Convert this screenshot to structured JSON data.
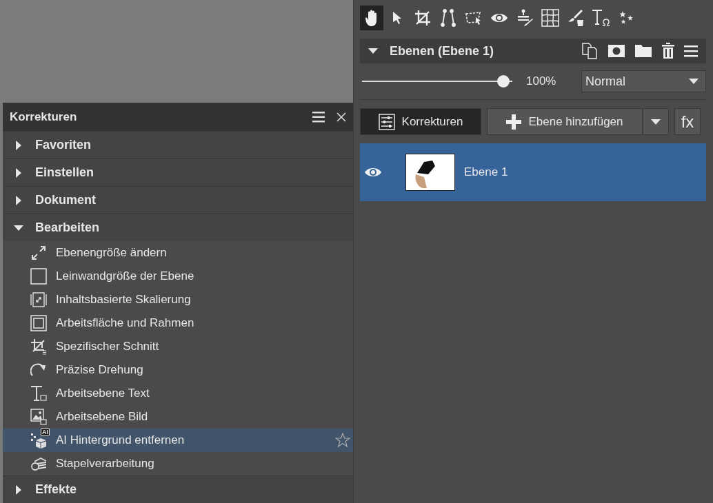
{
  "tools": [
    {
      "kind": "hand",
      "selected": true
    },
    {
      "kind": "pointer",
      "selected": false
    },
    {
      "kind": "crop",
      "selected": false
    },
    {
      "kind": "perspective",
      "selected": false
    },
    {
      "kind": "selection",
      "selected": false
    },
    {
      "kind": "eye",
      "selected": false
    },
    {
      "kind": "stamp",
      "selected": false
    },
    {
      "kind": "warp",
      "selected": false
    },
    {
      "kind": "brush",
      "selected": false
    },
    {
      "kind": "text",
      "selected": false
    },
    {
      "kind": "stars",
      "selected": false
    }
  ],
  "layers_panel": {
    "title": "Ebenen (Ebene 1)",
    "expanded": true,
    "opacity": {
      "level": 0.98,
      "reading": "100%"
    },
    "blend_mode": "Normal",
    "corrections_button": "Korrekturen",
    "add_layer_button": "Ebene hinzufügen",
    "fx_button": "fx",
    "layers": [
      {
        "name": "Ebene 1",
        "visible": true,
        "selected": true
      }
    ]
  },
  "corrections_panel": {
    "title": "Korrekturen",
    "categories": [
      {
        "label": "Favoriten",
        "expanded": false
      },
      {
        "label": "Einstellen",
        "expanded": false
      },
      {
        "label": "Dokument",
        "expanded": false
      },
      {
        "label": "Bearbeiten",
        "expanded": true,
        "items": [
          {
            "kind": "resize",
            "label": "Ebenengröße ändern",
            "selected": false
          },
          {
            "kind": "canvas",
            "label": "Leinwandgröße der Ebene",
            "selected": false
          },
          {
            "kind": "content-scale",
            "label": "Inhaltsbasierte Skalierung",
            "selected": false
          },
          {
            "kind": "artboard",
            "label": "Arbeitsfläche und Rahmen",
            "selected": false
          },
          {
            "kind": "crop",
            "label": "Spezifischer Schnitt",
            "selected": false
          },
          {
            "kind": "rotate",
            "label": "Präzise Drehung",
            "selected": false
          },
          {
            "kind": "text-layer",
            "label": "Arbeitsebene Text",
            "selected": false
          },
          {
            "kind": "image-layer",
            "label": "Arbeitsebene Bild",
            "selected": false
          },
          {
            "kind": "ai-remove",
            "label": "AI Hintergrund entfernen",
            "badge": "AI",
            "selected": true
          },
          {
            "kind": "batch",
            "label": "Stapelverarbeitung",
            "selected": false
          }
        ]
      },
      {
        "label": "Effekte",
        "expanded": false
      }
    ]
  }
}
